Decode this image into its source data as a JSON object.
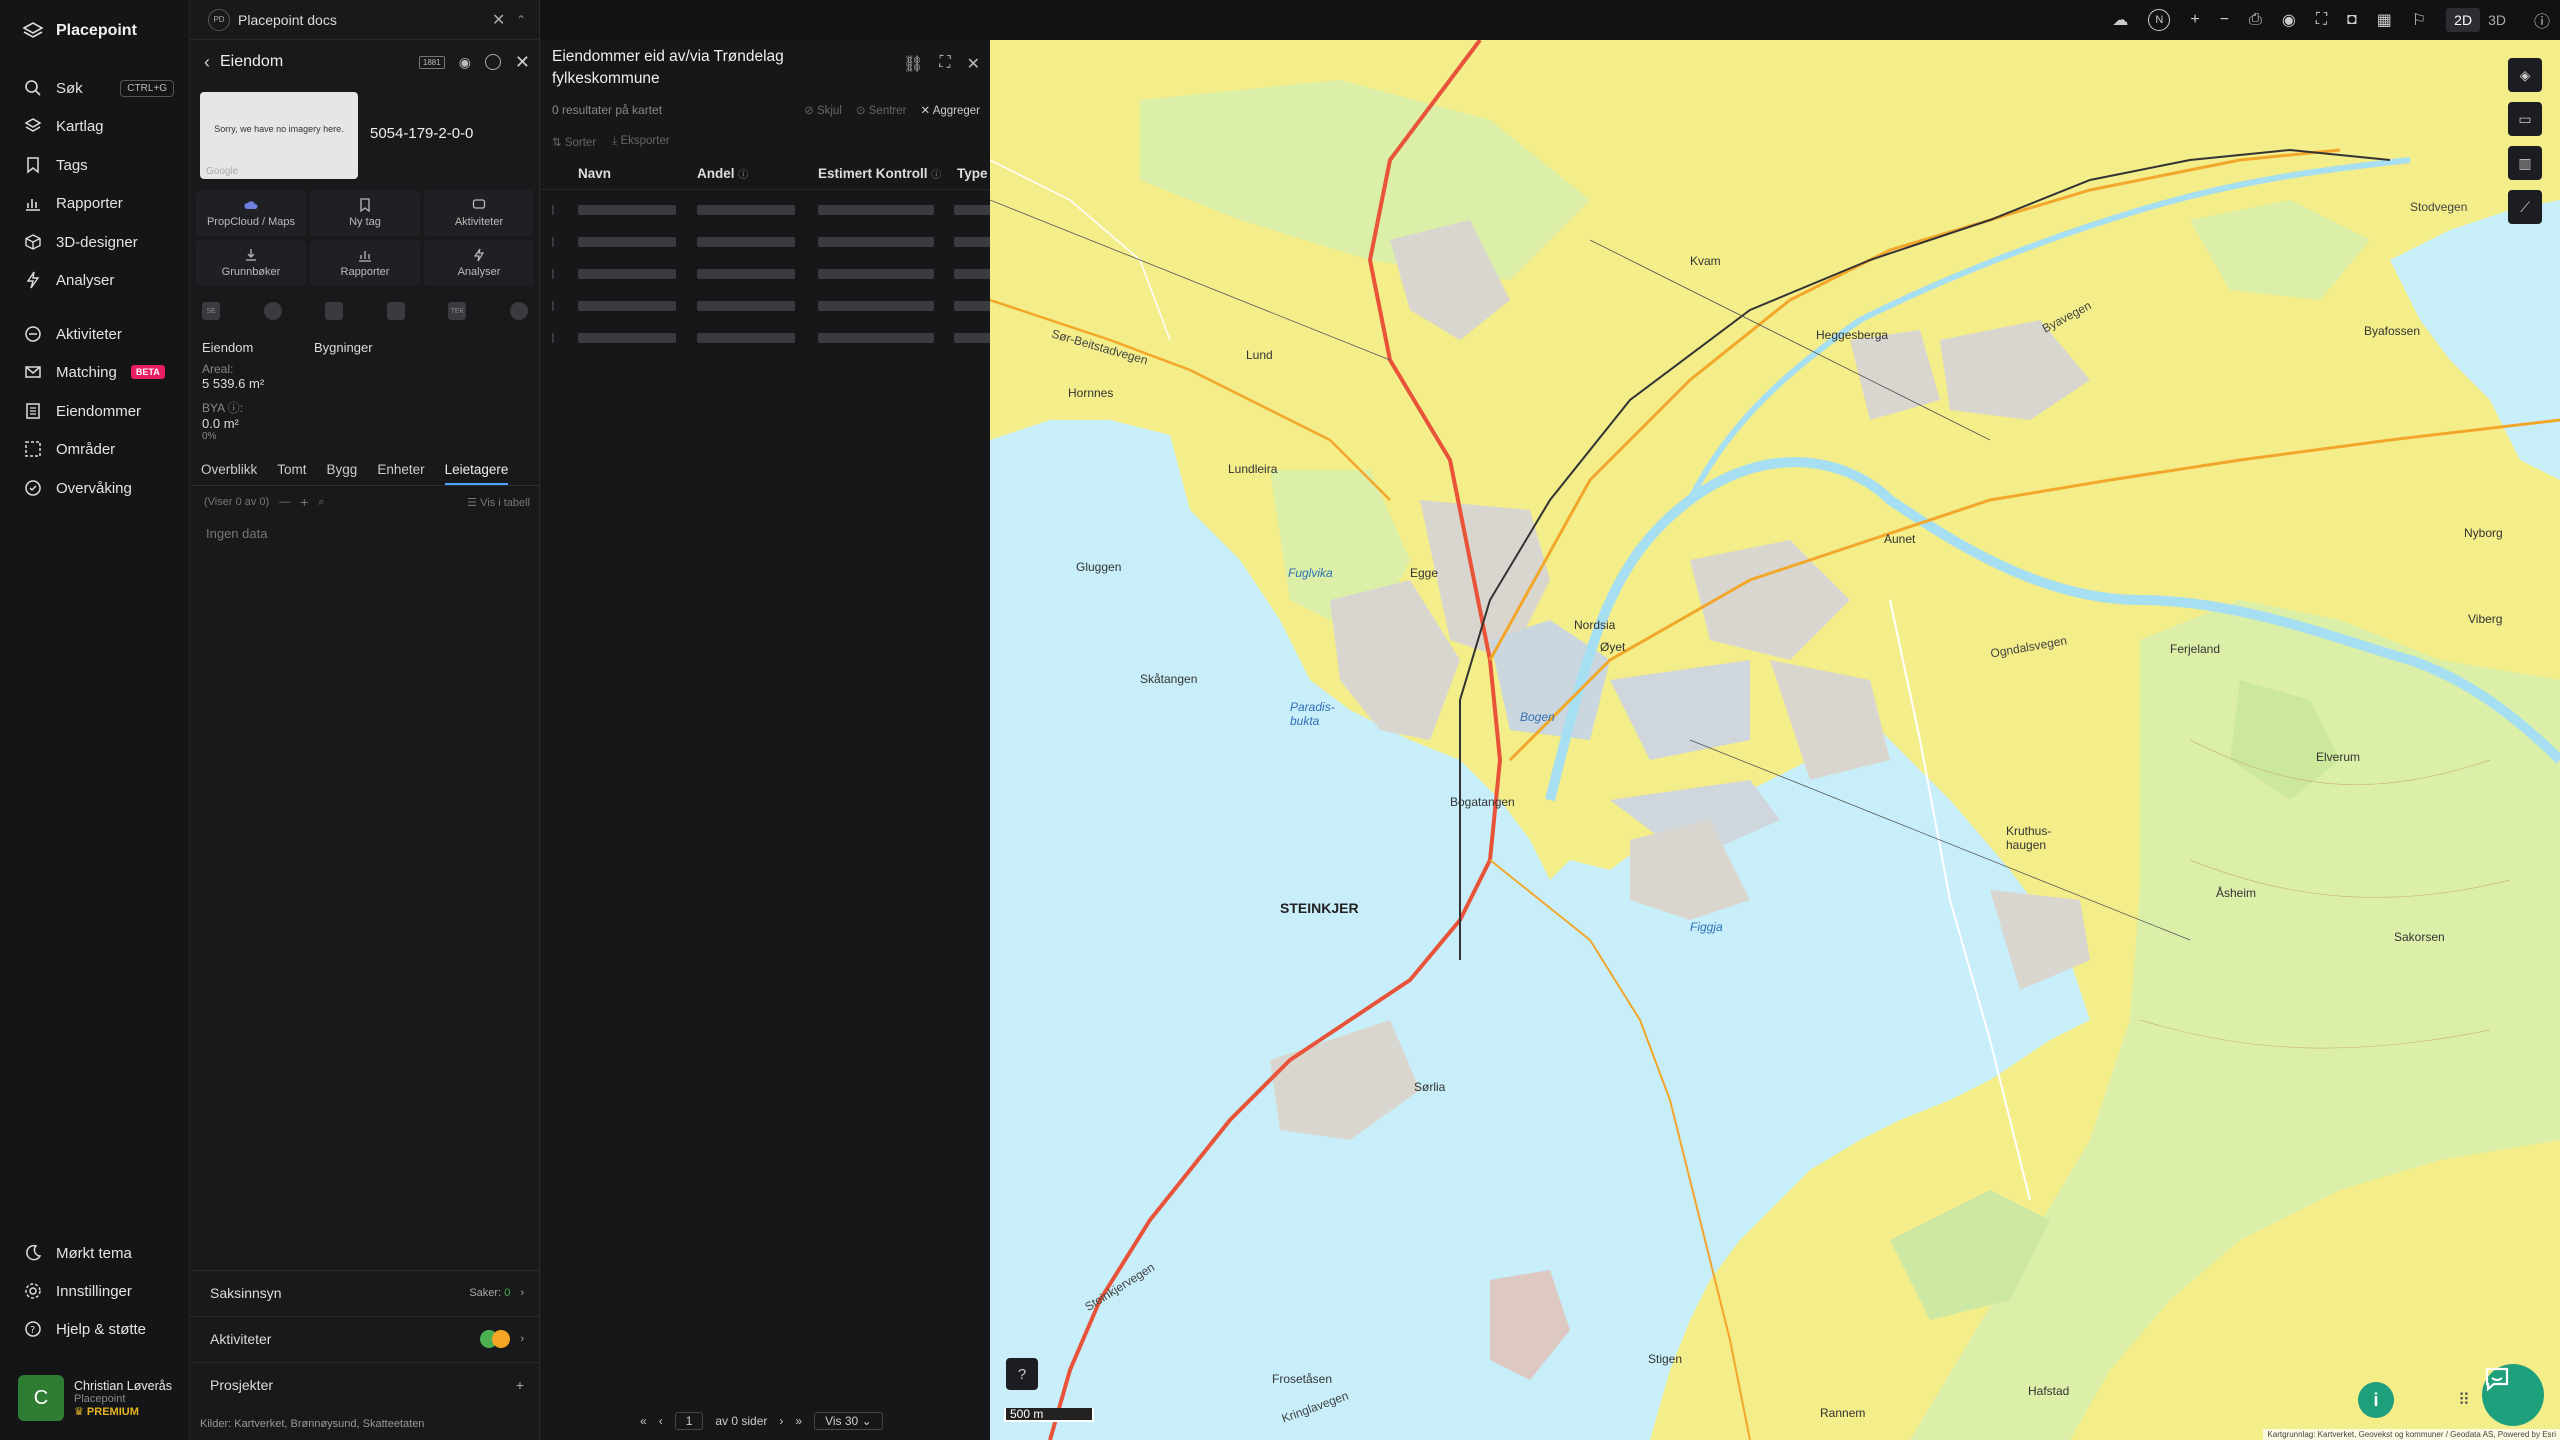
{
  "app": {
    "name": "Placepoint"
  },
  "nav": {
    "top_items": [
      {
        "id": "sok",
        "label": "Søk",
        "shortcut": "CTRL+G"
      },
      {
        "id": "kartlag",
        "label": "Kartlag"
      },
      {
        "id": "tags",
        "label": "Tags"
      },
      {
        "id": "rapporter",
        "label": "Rapporter"
      },
      {
        "id": "3d",
        "label": "3D-designer"
      },
      {
        "id": "analyser",
        "label": "Analyser"
      }
    ],
    "mid_items": [
      {
        "id": "aktiviteter",
        "label": "Aktiviteter"
      },
      {
        "id": "matching",
        "label": "Matching",
        "badge": "BETA"
      },
      {
        "id": "eiendommer",
        "label": "Eiendommer"
      },
      {
        "id": "omrader",
        "label": "Områder"
      },
      {
        "id": "overvaking",
        "label": "Overvåking"
      }
    ],
    "bottom_items": [
      {
        "id": "tema",
        "label": "Mørkt tema"
      },
      {
        "id": "innstillinger",
        "label": "Innstillinger"
      },
      {
        "id": "hjelp",
        "label": "Hjelp & støtte"
      }
    ],
    "user": {
      "initial": "C",
      "name": "Christian Løverås",
      "org": "Placepoint",
      "plan": "PREMIUM"
    }
  },
  "doc_tab": {
    "icon_text": "PD",
    "title": "Placepoint docs"
  },
  "property": {
    "header": "Eiendom",
    "header_badge": "1881",
    "imagery_text": "Sorry, we have no imagery here.",
    "imagery_source": "Google",
    "id": "5054-179-2-0-0",
    "actions": [
      {
        "label": "PropCloud / Maps"
      },
      {
        "label": "Ny tag"
      },
      {
        "label": "Aktiviteter"
      },
      {
        "label": "Grunnbøker"
      },
      {
        "label": "Rapporter"
      },
      {
        "label": "Analyser"
      }
    ],
    "icon_row": [
      "SE",
      "",
      "",
      "",
      "TEK",
      ""
    ],
    "tab_eiendom": "Eiendom",
    "tab_bygninger": "Bygninger",
    "areal_label": "Areal:",
    "areal_value": "5 539.6",
    "bya_label": "BYA ⓘ:",
    "bya_value": "0.0",
    "bya_pct": "0%",
    "unit": "m²",
    "subtabs": [
      "Overblikk",
      "Tomt",
      "Bygg",
      "Enheter",
      "Leietagere"
    ],
    "active_subtab": "Leietagere",
    "list_counter": "(Viser 0 av 0)",
    "vis_i_tabell": "Vis i tabell",
    "no_data": "Ingen data",
    "saksinnsyn": {
      "label": "Saksinnsyn",
      "count_label": "Saker:",
      "count": "0"
    },
    "aktiviteter": {
      "label": "Aktiviteter"
    },
    "prosjekter": {
      "label": "Prosjekter"
    },
    "kilder": {
      "label": "Kilder:",
      "items": [
        "Kartverket,",
        "Brønnøysund,",
        "Skatteetaten"
      ]
    }
  },
  "owned": {
    "title": "Eiendommer eid av/via Trøndelag fylkeskommune",
    "count": "0 resultater på kartet",
    "actions": {
      "skjul": "Skjul",
      "sentrer": "Sentrer",
      "aggreger": "Aggreger"
    },
    "actions2": {
      "sorter": "Sorter",
      "eksporter": "Eksporter"
    },
    "columns": [
      "Navn",
      "Andel",
      "Estimert Kontroll",
      "Type"
    ],
    "pager": {
      "page": "1",
      "of_pages": "av 0 sider",
      "per_page": "Vis 30"
    }
  },
  "map": {
    "view_modes": [
      "2D",
      "3D"
    ],
    "active_mode": "2D",
    "compass": "N",
    "scale": "500 m",
    "labels": {
      "steinkjer": "STEINKJER",
      "beitstadvegen": "Sør-Beitstadvegen",
      "stodvegen": "Stodvegen",
      "ogndalsvegen": "Ogndalsvegen",
      "byavegen": "Byavegen",
      "bogen": "Bogen",
      "bogatangen": "Bogatangen",
      "lundleira": "Lundleira",
      "gluggen": "Gluggen",
      "fuglvika": "Fuglvika",
      "paradisbukta": "Paradis-bukta",
      "skatangen": "Skåtangen",
      "figgja": "Figgja",
      "egge": "Egge",
      "sorlia": "Sørlia",
      "kvam": "Kvam",
      "heggesberga": "Heggesberga",
      "lund": "Lund",
      "hornnes": "Hornnes",
      "byafossen": "Byafossen",
      "nordsia": "Nordsia",
      "oyet": "Øyet",
      "kruthus": "Kruthus-haugen",
      "asheim": "Åsheim",
      "stigen": "Stigen",
      "frosetasen": "Frosetåsen",
      "kringlavegen": "Kringlavegen",
      "steinkjervegen": "Steinkjervegen",
      "rannem": "Rannem",
      "auna": "Aunet",
      "elverum": "Elverum",
      "sakorsen": "Sakorsen",
      "nyborg": "Nyborg",
      "viberg": "Viberg",
      "ferjeland": "Ferjeland",
      "hafstad": "Hafstad"
    },
    "attribution": "Kartgrunnlag: Kartverket, Geovekst og kommuner / Geodata AS, Powered by Esri"
  }
}
